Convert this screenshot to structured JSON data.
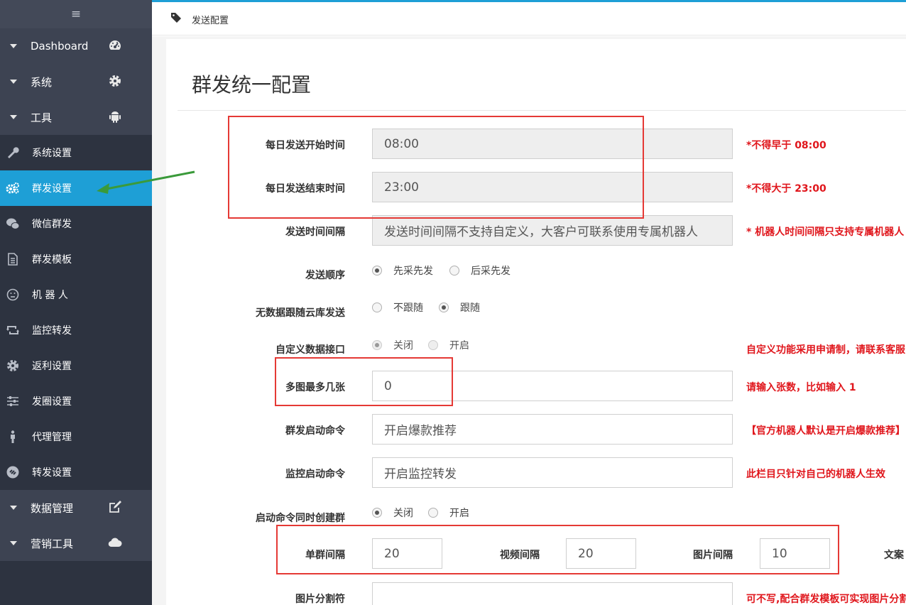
{
  "sidebar": {
    "menu_icon": "≡",
    "groups": {
      "dashboard": {
        "label": "Dashboard",
        "icon": "dashboard-icon"
      },
      "system": {
        "label": "系统",
        "icon": "gear-icon"
      },
      "tools": {
        "label": "工具",
        "icon": "android-icon"
      },
      "data": {
        "label": "数据管理",
        "icon": "edit-icon"
      },
      "marketing": {
        "label": "营销工具",
        "icon": "cloud-icon"
      }
    },
    "items": [
      {
        "label": "系统设置",
        "icon": "wrench-icon"
      },
      {
        "label": "群发设置",
        "icon": "gears-icon",
        "active": true
      },
      {
        "label": "微信群发",
        "icon": "wechat-icon"
      },
      {
        "label": "群发模板",
        "icon": "document-icon"
      },
      {
        "label": "机 器 人",
        "icon": "smiley-icon"
      },
      {
        "label": "监控转发",
        "icon": "retweet-icon"
      },
      {
        "label": "返利设置",
        "icon": "cog-icon"
      },
      {
        "label": "发圈设置",
        "icon": "sliders-icon"
      },
      {
        "label": "代理管理",
        "icon": "person-icon"
      },
      {
        "label": "转发设置",
        "icon": "link-icon"
      }
    ]
  },
  "breadcrumb": "发送配置",
  "page_title": "群发统一配置",
  "form": {
    "start_time": {
      "label": "每日发送开始时间",
      "value": "08:00",
      "hint": "*不得早于 08:00"
    },
    "end_time": {
      "label": "每日发送结束时间",
      "value": "23:00",
      "hint": "*不得大于 23:00"
    },
    "interval": {
      "label": "发送时间间隔",
      "value": "发送时间间隔不支持自定义，大客户可联系使用专属机器人",
      "hint": "* 机器人时间间隔只支持专属机器人"
    },
    "order": {
      "label": "发送顺序",
      "opt1": "先采先发",
      "opt2": "后采先发",
      "selected": "先采先发"
    },
    "follow": {
      "label": "无数据跟随云库发送",
      "opt1": "不跟随",
      "opt2": "跟随",
      "selected": "跟随"
    },
    "custom_api": {
      "label": "自定义数据接口",
      "opt1": "关闭",
      "opt2": "开启",
      "selected": "关闭",
      "hint": "自定义功能采用申请制，请联系客服"
    },
    "max_images": {
      "label": "多图最多几张",
      "value": "0",
      "hint": "请输入张数，比如输入 1"
    },
    "start_cmd": {
      "label": "群发启动命令",
      "placeholder": "开启爆款推荐",
      "hint": "【官方机器人默认是开启爆款推荐】"
    },
    "monitor_cmd": {
      "label": "监控启动命令",
      "placeholder": "开启监控转发",
      "hint": "此栏目只针对自己的机器人生效"
    },
    "create_group": {
      "label": "启动命令同时创建群",
      "opt1": "关闭",
      "opt2": "开启",
      "selected": "关闭"
    },
    "single_interval": {
      "label": "单群间隔",
      "value": "20"
    },
    "video_interval": {
      "label": "视频间隔",
      "value": "20"
    },
    "image_interval": {
      "label": "图片间隔",
      "value": "10"
    },
    "copy_interval": {
      "label": "文案"
    },
    "image_separator": {
      "label": "图片分割符",
      "value": "",
      "hint": "可不写,配合群发模板可实现图片分割"
    }
  },
  "colors": {
    "accent": "#1e9fd6",
    "sidebar": "#2d3340",
    "hint_red": "#e0161c",
    "annotation": "#e53935"
  }
}
